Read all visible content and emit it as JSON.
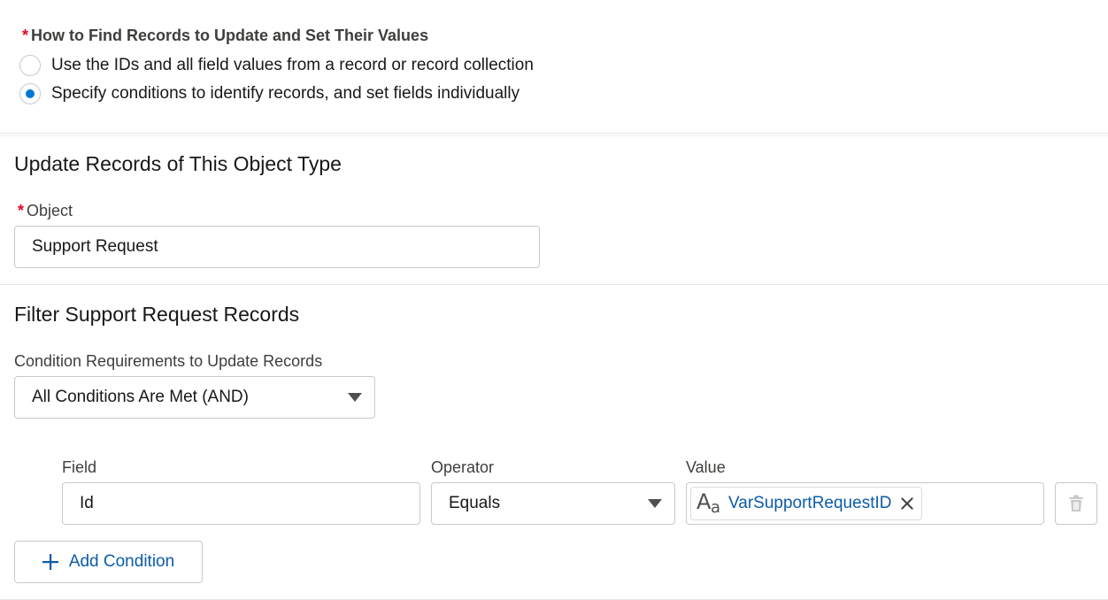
{
  "find_records": {
    "title": "How to Find Records to Update and Set Their Values",
    "required_marker": "*",
    "options": [
      {
        "label": "Use the IDs and all field values from a record or record collection",
        "selected": false
      },
      {
        "label": "Specify conditions to identify records, and set fields individually",
        "selected": true
      }
    ]
  },
  "object_section": {
    "heading": "Update Records of This Object Type",
    "object_label": "Object",
    "required_marker": "*",
    "object_value": "Support Request"
  },
  "filter_section": {
    "heading": "Filter Support Request Records",
    "condition_req_label": "Condition Requirements to Update Records",
    "condition_req_value": "All Conditions Are Met (AND)",
    "columns": {
      "field": "Field",
      "operator": "Operator",
      "value": "Value"
    },
    "conditions": [
      {
        "field": "Id",
        "operator": "Equals",
        "value": "VarSupportRequestID",
        "value_icon": "text-type-icon",
        "value_icon_glyph_big": "A",
        "value_icon_glyph_small": "a"
      }
    ],
    "add_condition_label": "Add Condition"
  },
  "colors": {
    "accent": "#0176d3",
    "link": "#0b5cab",
    "required": "#ea001e",
    "border": "#c9c9c9"
  }
}
